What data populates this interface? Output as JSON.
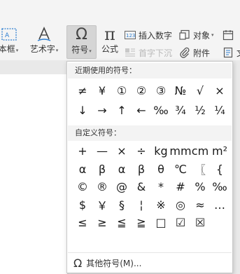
{
  "ribbon": {
    "textbox_label": "本框",
    "wordart_label": "艺术字",
    "symbol_label": "符号",
    "formula_label": "公式",
    "insert_number_label": "插入数字",
    "object_label": "对象",
    "dropcap_label": "首字下沉",
    "attachment_label": "附件",
    "partial_label": "文",
    "dropdown_arrow": "▾",
    "icons": {
      "symbol": "Ω",
      "formula": "π"
    }
  },
  "symbol_panel": {
    "recent_title": "近期使用的符号：",
    "recent_symbols": [
      "≠",
      "¥",
      "①",
      "②",
      "③",
      "№",
      "√",
      "×",
      "↓",
      "→",
      "↑",
      "←",
      "‰",
      "¾",
      "½",
      "¼"
    ],
    "custom_title": "自定义符号：",
    "custom_symbols": [
      "+",
      "—",
      "×",
      "÷",
      "kg",
      "mm",
      "cm",
      "m²",
      "α",
      "β",
      "α",
      "β",
      "θ",
      "℃",
      "〖",
      "{",
      "©",
      "®",
      "@",
      "&",
      "*",
      "#",
      "%",
      "‰",
      "$",
      "￥",
      "§",
      "¦",
      "※",
      "◎",
      "≈",
      "…",
      "≤",
      "≥",
      "≦",
      "≧",
      "□",
      "☑",
      "☒",
      ""
    ],
    "more_label": "其他符号(M)...",
    "more_icon": "Ω"
  }
}
